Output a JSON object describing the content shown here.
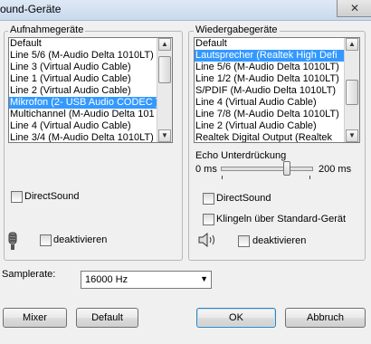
{
  "window": {
    "title": "ound-Geräte",
    "close_glyph": "✕"
  },
  "recording": {
    "group_label": "Aufnahmegeräte",
    "items": [
      "Default",
      "Line 5/6 (M-Audio Delta 1010LT)",
      "Line 3 (Virtual Audio Cable)",
      "Line 1 (Virtual Audio Cable)",
      "Line 2 (Virtual Audio Cable)",
      "Mikrofon (2- USB Audio CODEC )",
      "Multichannel (M-Audio Delta 101",
      "Line 4 (Virtual Audio Cable)",
      "Line 3/4 (M-Audio Delta 1010LT)"
    ],
    "selected_index": 5,
    "directsound_label": "DirectSound",
    "disable_label": "deaktivieren",
    "mic_icon": "microphone-icon"
  },
  "playback": {
    "group_label": "Wiedergabegeräte",
    "items": [
      "Default",
      "Lautsprecher (Realtek High Defi",
      "Line 5/6 (M-Audio Delta 1010LT)",
      "Line 1/2 (M-Audio Delta 1010LT)",
      "S/PDIF (M-Audio Delta 1010LT)",
      "Line 4 (Virtual Audio Cable)",
      "Line 7/8 (M-Audio Delta 1010LT)",
      "Line 2 (Virtual Audio Cable)",
      "Realtek Digital Output (Realtek"
    ],
    "selected_index": 1,
    "echo_label": "Echo Unterdrückung",
    "echo_min": "0 ms",
    "echo_max": "200 ms",
    "echo_value_fraction": 0.73,
    "directsound_label": "DirectSound",
    "ring_label": "Klingeln über Standard-Gerät",
    "disable_label": "deaktivieren",
    "speaker_icon": "speaker-icon"
  },
  "samplerate": {
    "label": "Samplerate:",
    "value": "16000 Hz"
  },
  "buttons": {
    "mixer": "Mixer",
    "default": "Default",
    "ok": "OK",
    "cancel": "Abbruch"
  },
  "colors": {
    "selection": "#3399ff",
    "window_bg": "#f0f0f0"
  }
}
